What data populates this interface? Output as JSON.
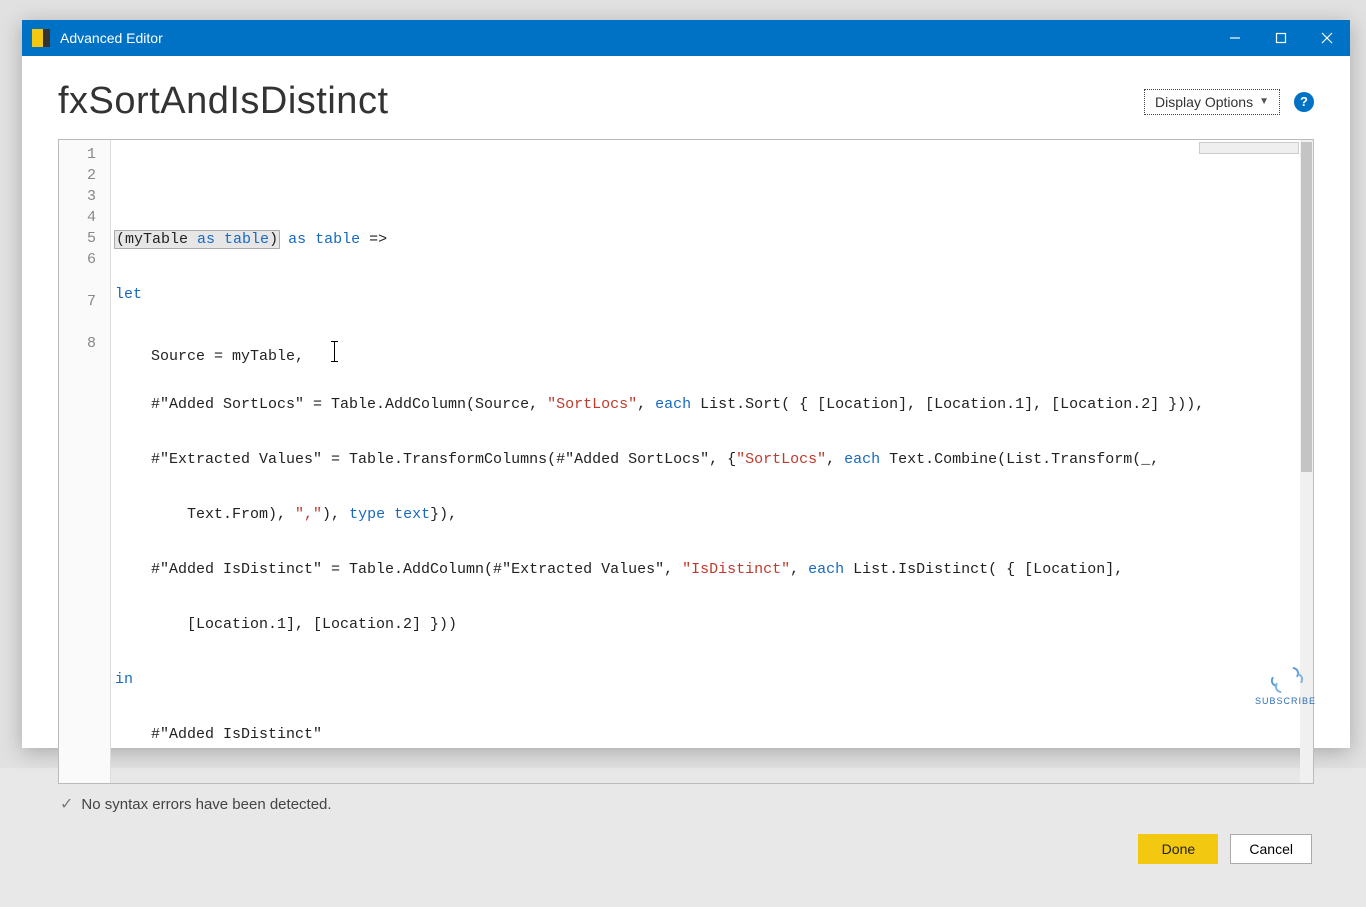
{
  "window": {
    "title": "Advanced Editor"
  },
  "header": {
    "query_name": "fxSortAndIsDistinct",
    "display_options_label": "Display Options",
    "help_glyph": "?"
  },
  "code": {
    "line_numbers": [
      "1",
      "2",
      "3",
      "4",
      "5",
      "6",
      "7",
      "8"
    ],
    "lines_plain": [
      "(myTable as table) as table =>",
      "let",
      "    Source = myTable,",
      "    #\"Added SortLocs\" = Table.AddColumn(Source, \"SortLocs\", each List.Sort( { [Location], [Location.1], [Location.2] })),",
      "    #\"Extracted Values\" = Table.TransformColumns(#\"Added SortLocs\", {\"SortLocs\", each Text.Combine(List.Transform(_,",
      "        Text.From), \",\"), type text}),",
      "    #\"Added IsDistinct\" = Table.AddColumn(#\"Extracted Values\", \"IsDistinct\", each List.IsDistinct( { [Location],",
      "        [Location.1], [Location.2] }))",
      "in",
      "    #\"Added IsDistinct\""
    ],
    "tokens": {
      "keywords": [
        "as",
        "let",
        "each",
        "type",
        "in"
      ],
      "types": [
        "table",
        "text"
      ],
      "strings": [
        "\"SortLocs\"",
        "\"IsDistinct\"",
        "\",\""
      ]
    }
  },
  "status": {
    "message": "No syntax errors have been detected."
  },
  "footer": {
    "done_label": "Done",
    "cancel_label": "Cancel"
  },
  "watermark": {
    "text": "SUBSCRIBE"
  }
}
